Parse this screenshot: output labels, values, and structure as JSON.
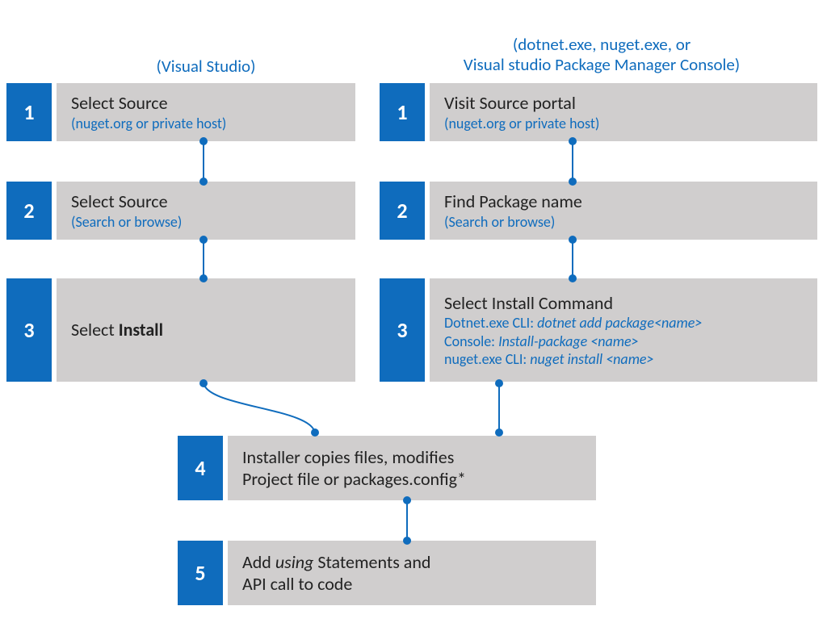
{
  "left": {
    "heading": "(Visual Studio)",
    "steps": [
      {
        "num": "1",
        "title": "Select Source",
        "sub": "(nuget.org or private host)"
      },
      {
        "num": "2",
        "title": "Select Source",
        "sub": "(Search or browse)"
      },
      {
        "num": "3",
        "title_html": "Select <strong>Install</strong>"
      }
    ]
  },
  "right": {
    "heading": "(dotnet.exe, nuget.exe, or\nVisual studio Package Manager Console)",
    "steps": [
      {
        "num": "1",
        "title": "Visit Source portal",
        "sub": "(nuget.org or private host)"
      },
      {
        "num": "2",
        "title": "Find Package name",
        "sub": "(Search or browse)"
      },
      {
        "num": "3",
        "title": "Select Install Command",
        "lines": [
          {
            "k": "Dotnet.exe CLI: ",
            "cmd": "dotnet add package<name>"
          },
          {
            "k": "Console: ",
            "cmd": "Install-package <name>"
          },
          {
            "k": "nuget.exe CLI: ",
            "cmd": "nuget install <name>"
          }
        ]
      }
    ]
  },
  "bottom": {
    "steps": [
      {
        "num": "4",
        "title": "Installer copies files, modifies\nProject file or packages.config*"
      },
      {
        "num": "5",
        "title_html": "Add <em>using</em> Statements and\nAPI call to code"
      }
    ]
  }
}
